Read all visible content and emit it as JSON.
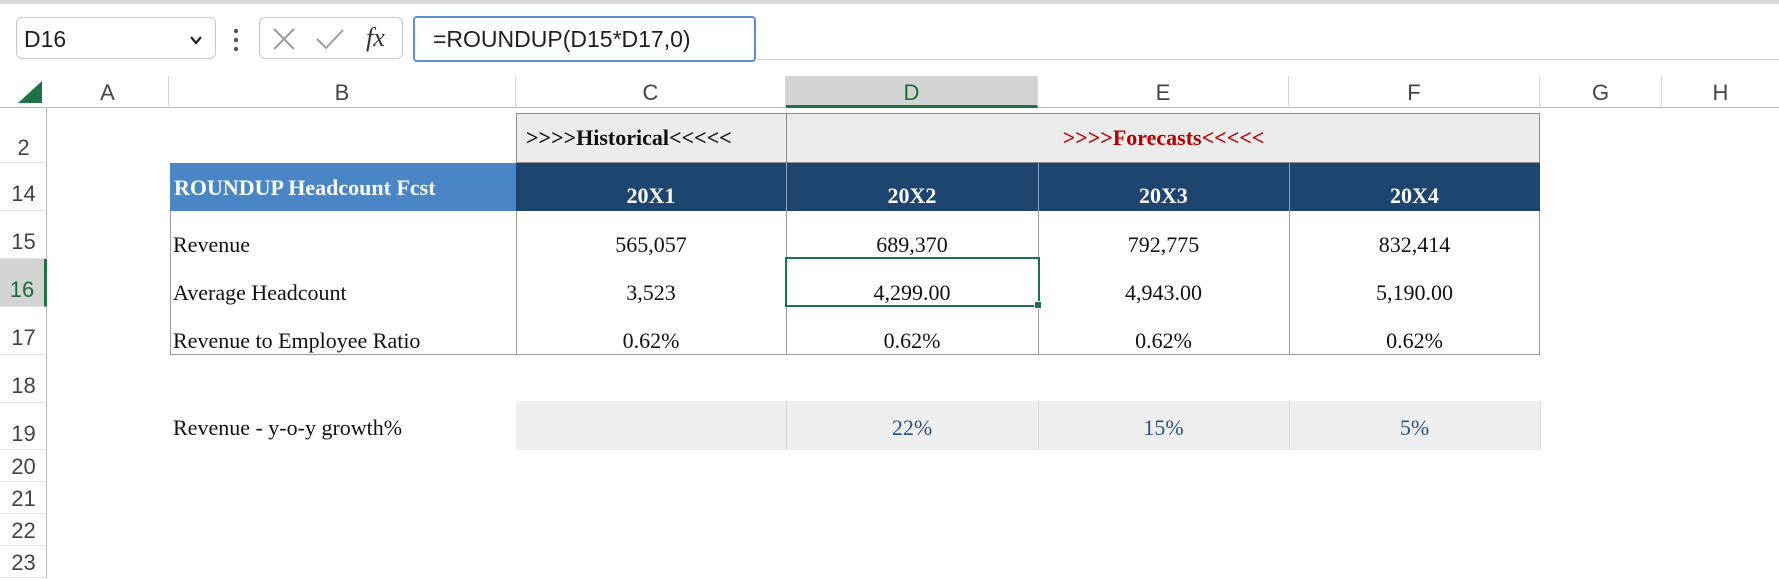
{
  "formula_bar": {
    "name_box": "D16",
    "formula": "=ROUNDUP(D15*D17,0)",
    "cancel_icon": "x-icon",
    "enter_icon": "check-icon",
    "function_icon": "fx-icon"
  },
  "columns": [
    "A",
    "B",
    "C",
    "D",
    "E",
    "F",
    "G",
    "H"
  ],
  "rows": [
    "2",
    "14",
    "15",
    "16",
    "17",
    "18",
    "19",
    "20",
    "21",
    "22",
    "23"
  ],
  "selected": {
    "column": "D",
    "row": "16"
  },
  "sheet": {
    "historical_header": ">>>>Historical<<<<<",
    "forecasts_header": ">>>>Forecasts<<<<<",
    "title": "ROUNDUP Headcount Fcst",
    "years": [
      "20X1",
      "20X2",
      "20X3",
      "20X4"
    ],
    "table": [
      {
        "label": "Revenue",
        "values": [
          "565,057",
          "689,370",
          "792,775",
          "832,414"
        ]
      },
      {
        "label": "Average Headcount",
        "values": [
          "3,523",
          "4,299.00",
          "4,943.00",
          "5,190.00"
        ]
      },
      {
        "label": "Revenue to Employee Ratio",
        "values": [
          "0.62%",
          "0.62%",
          "0.62%",
          "0.62%"
        ]
      }
    ],
    "growth": {
      "label": "Revenue - y-o-y growth%",
      "values": [
        "",
        "22%",
        "15%",
        "5%"
      ]
    }
  },
  "colors": {
    "title_fill": "#4a86c5",
    "year_band": "#1d4570",
    "forecast_text": "#b00000",
    "growth_text": "#2d4f86",
    "selection_green": "#1f7244"
  }
}
